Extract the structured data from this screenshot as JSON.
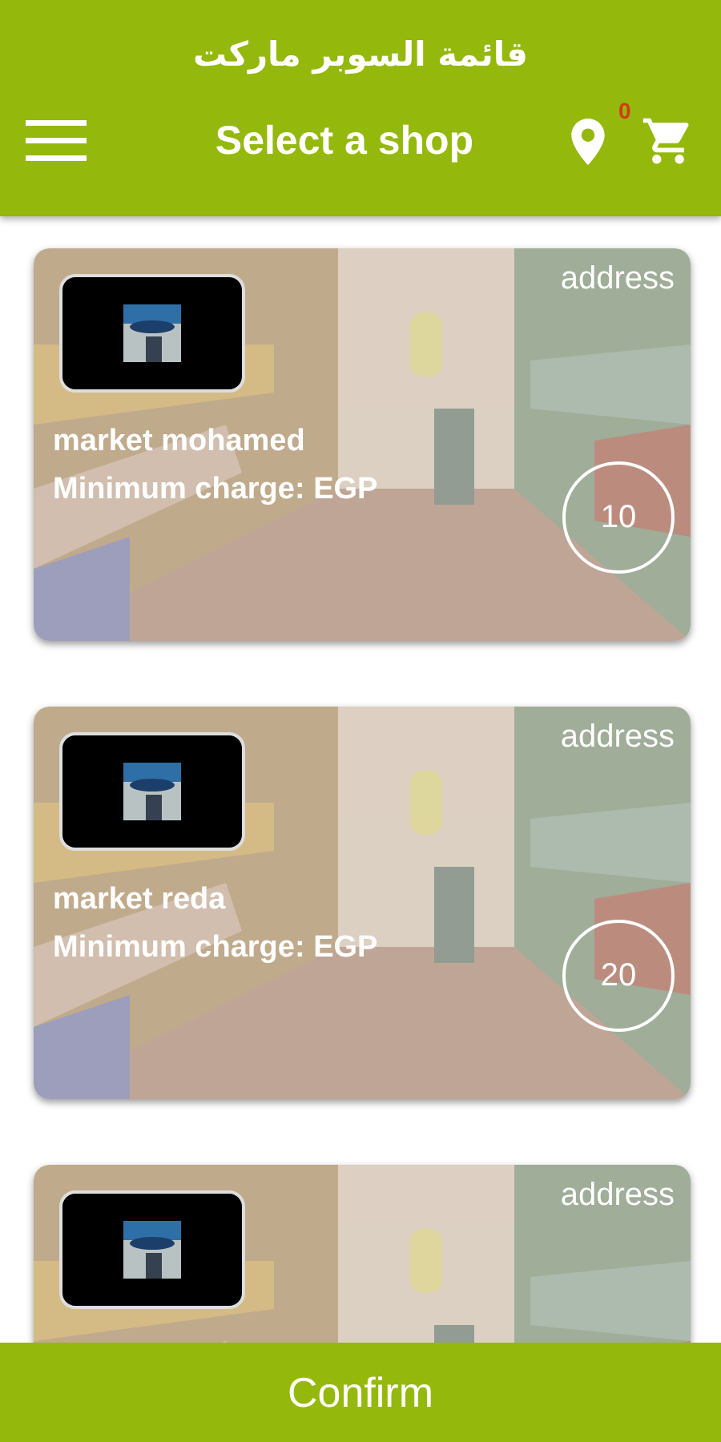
{
  "app_title": "قائمة السوبر ماركت",
  "toolbar": {
    "title": "Select a shop",
    "cart_count": "0"
  },
  "shops": [
    {
      "address": "address",
      "name": "market  mohamed",
      "min_charge": "Minimum charge:  EGP",
      "count": "10"
    },
    {
      "address": "address",
      "name": "market reda",
      "min_charge": "Minimum charge:  EGP",
      "count": "20"
    },
    {
      "address": "address"
    }
  ],
  "confirm_button": "Confirm"
}
